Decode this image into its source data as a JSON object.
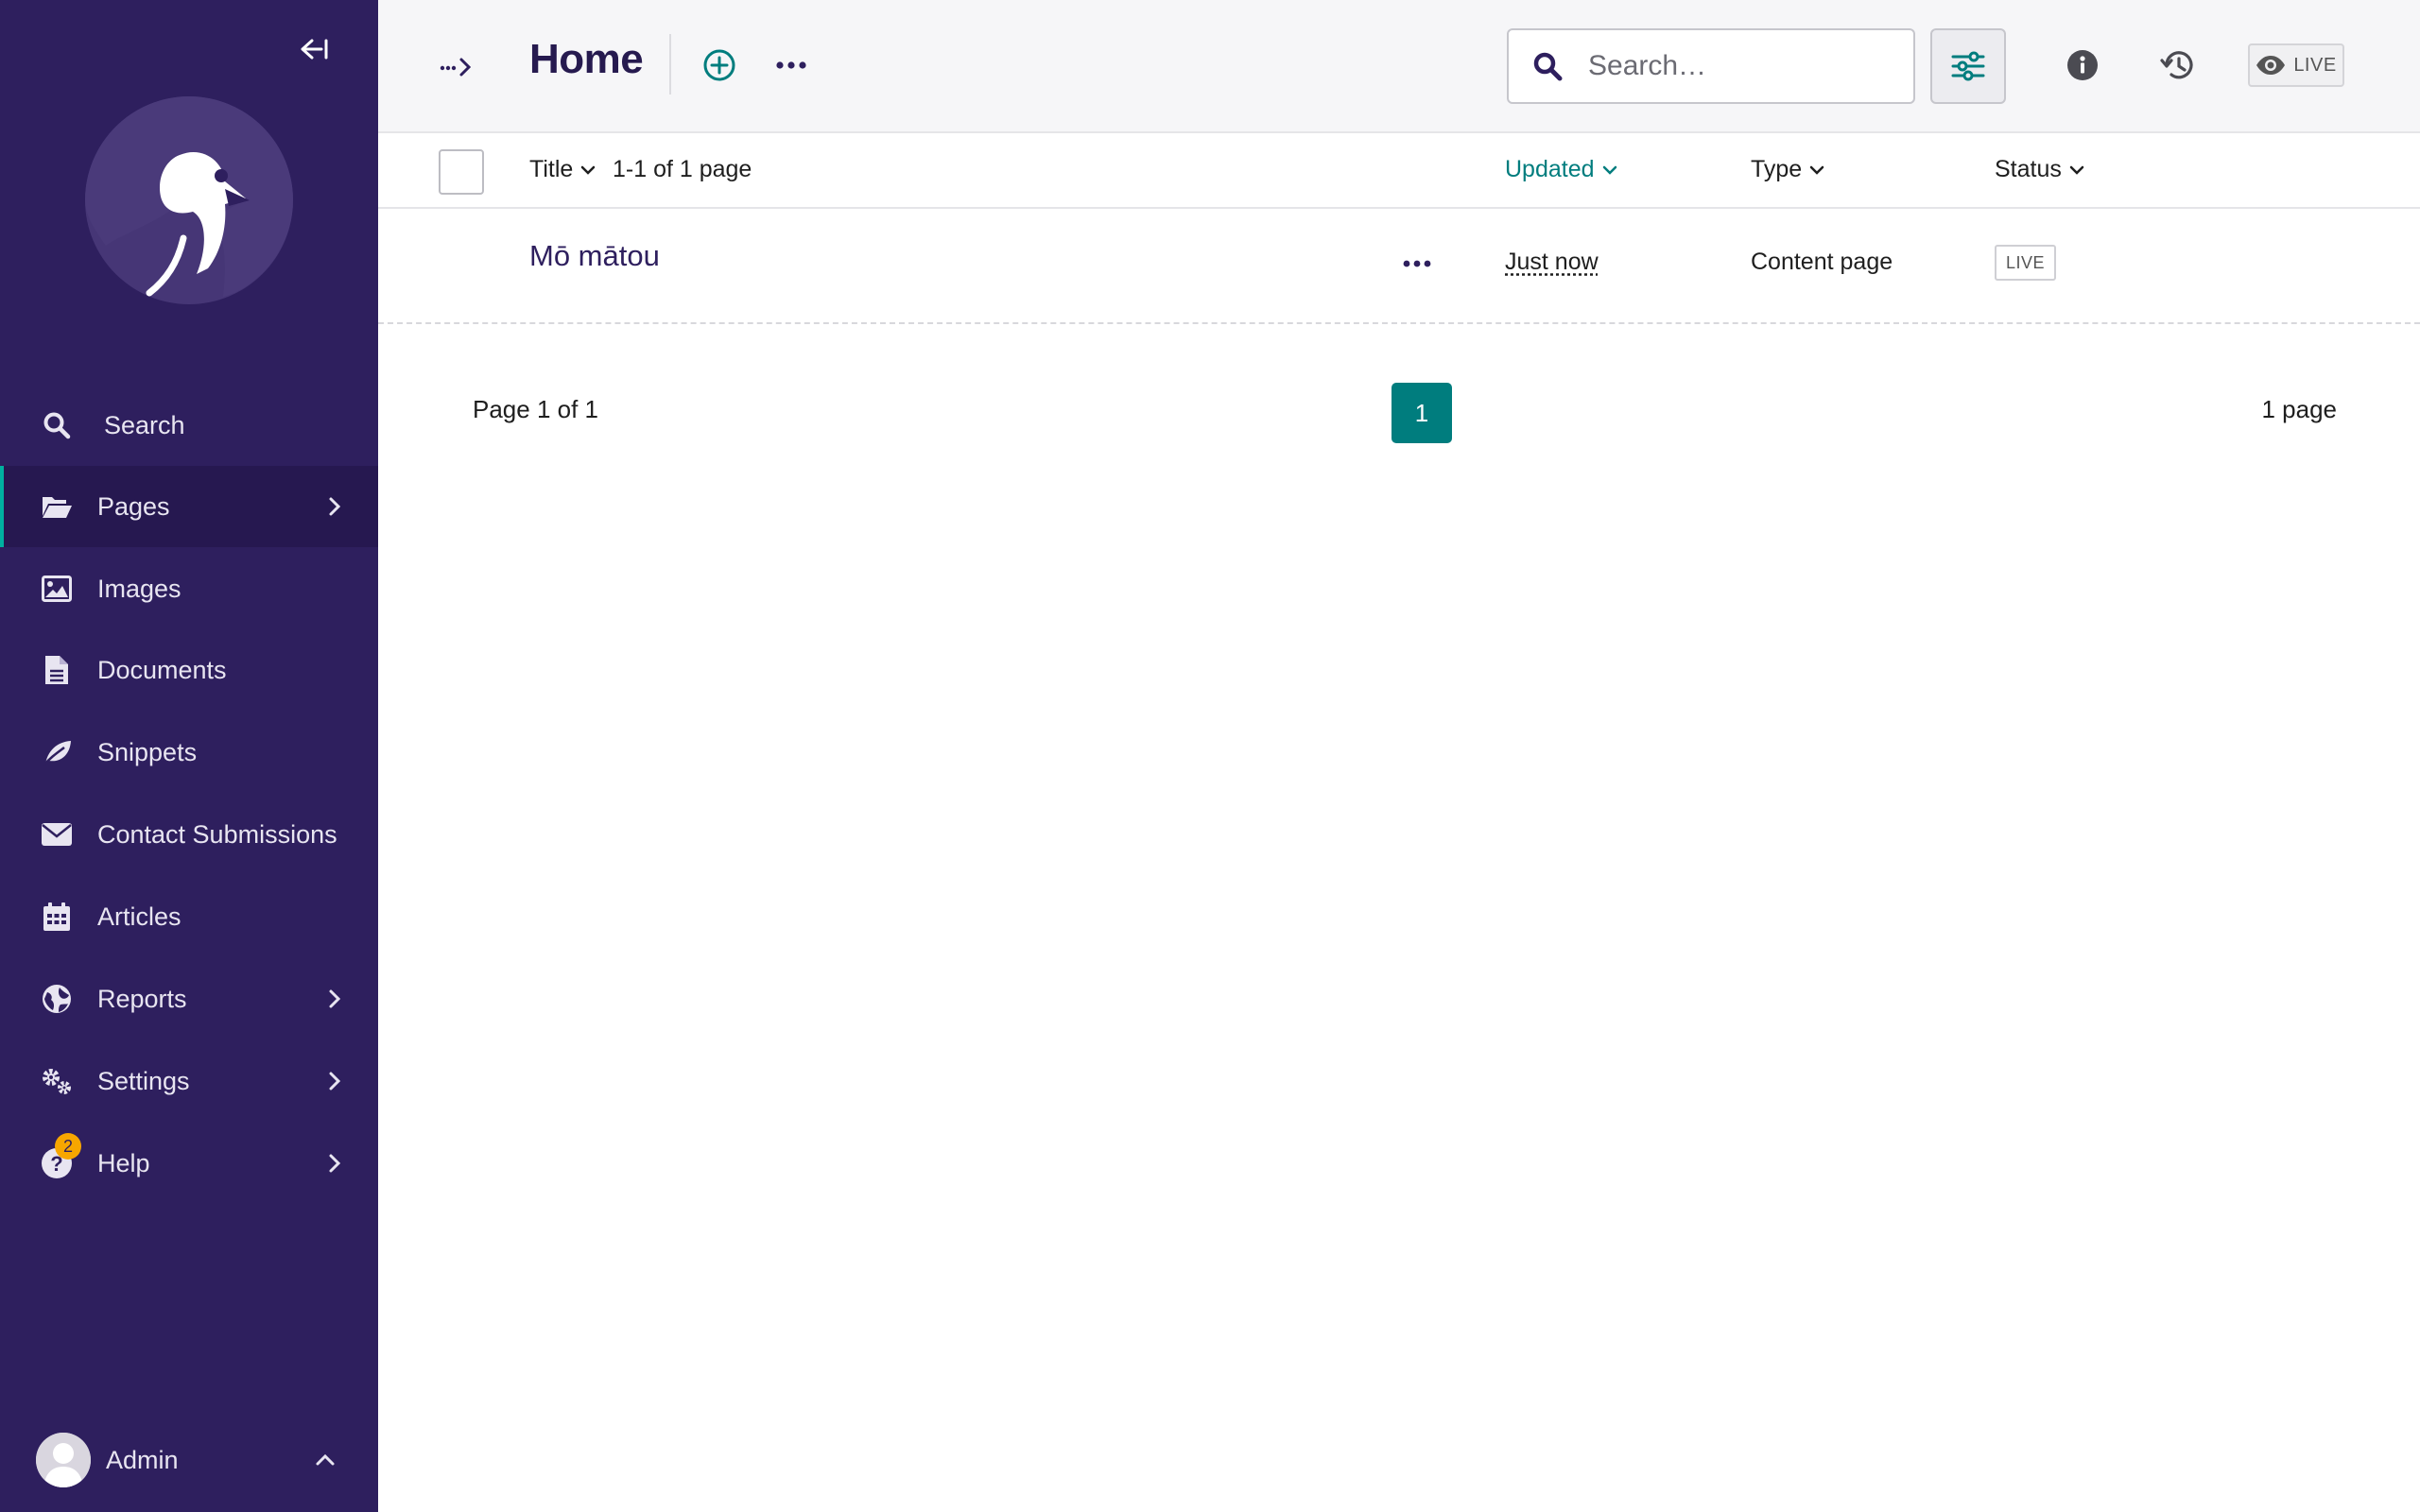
{
  "sidebar": {
    "collapse_icon": "collapse-left-icon",
    "logo": "wagtail-bird-logo",
    "items": [
      {
        "label": "Search",
        "icon": "search-icon",
        "has_children": false,
        "active": false
      },
      {
        "label": "Pages",
        "icon": "folder-open-icon",
        "has_children": true,
        "active": true
      },
      {
        "label": "Images",
        "icon": "image-icon",
        "has_children": false,
        "active": false
      },
      {
        "label": "Documents",
        "icon": "document-icon",
        "has_children": false,
        "active": false
      },
      {
        "label": "Snippets",
        "icon": "snippet-leaf-icon",
        "has_children": false,
        "active": false
      },
      {
        "label": "Contact Submissions",
        "icon": "envelope-icon",
        "has_children": false,
        "active": false
      },
      {
        "label": "Articles",
        "icon": "calendar-icon",
        "has_children": false,
        "active": false
      },
      {
        "label": "Reports",
        "icon": "globe-icon",
        "has_children": true,
        "active": false
      },
      {
        "label": "Settings",
        "icon": "cogs-icon",
        "has_children": true,
        "active": false
      },
      {
        "label": "Help",
        "icon": "help-icon",
        "has_children": true,
        "active": false,
        "badge": "2"
      }
    ],
    "account": {
      "label": "Admin",
      "icon": "chevron-up-icon"
    }
  },
  "header": {
    "title": "Home",
    "search_placeholder": "Search…",
    "live_label": "LIVE"
  },
  "listing": {
    "columns": {
      "title": "Title",
      "updated": "Updated",
      "type": "Type",
      "status": "Status"
    },
    "count_text": "1-1 of 1 page",
    "rows": [
      {
        "title": "Mō mātou",
        "updated": "Just now",
        "type": "Content page",
        "status": "LIVE"
      }
    ]
  },
  "pagination": {
    "info": "Page 1 of 1",
    "current_page": "1",
    "total": "1 page"
  },
  "colors": {
    "sidebar_bg": "#2e1f5e",
    "accent_teal": "#007d7e",
    "badge": "#f7a600",
    "title_purple": "#261a4f"
  }
}
